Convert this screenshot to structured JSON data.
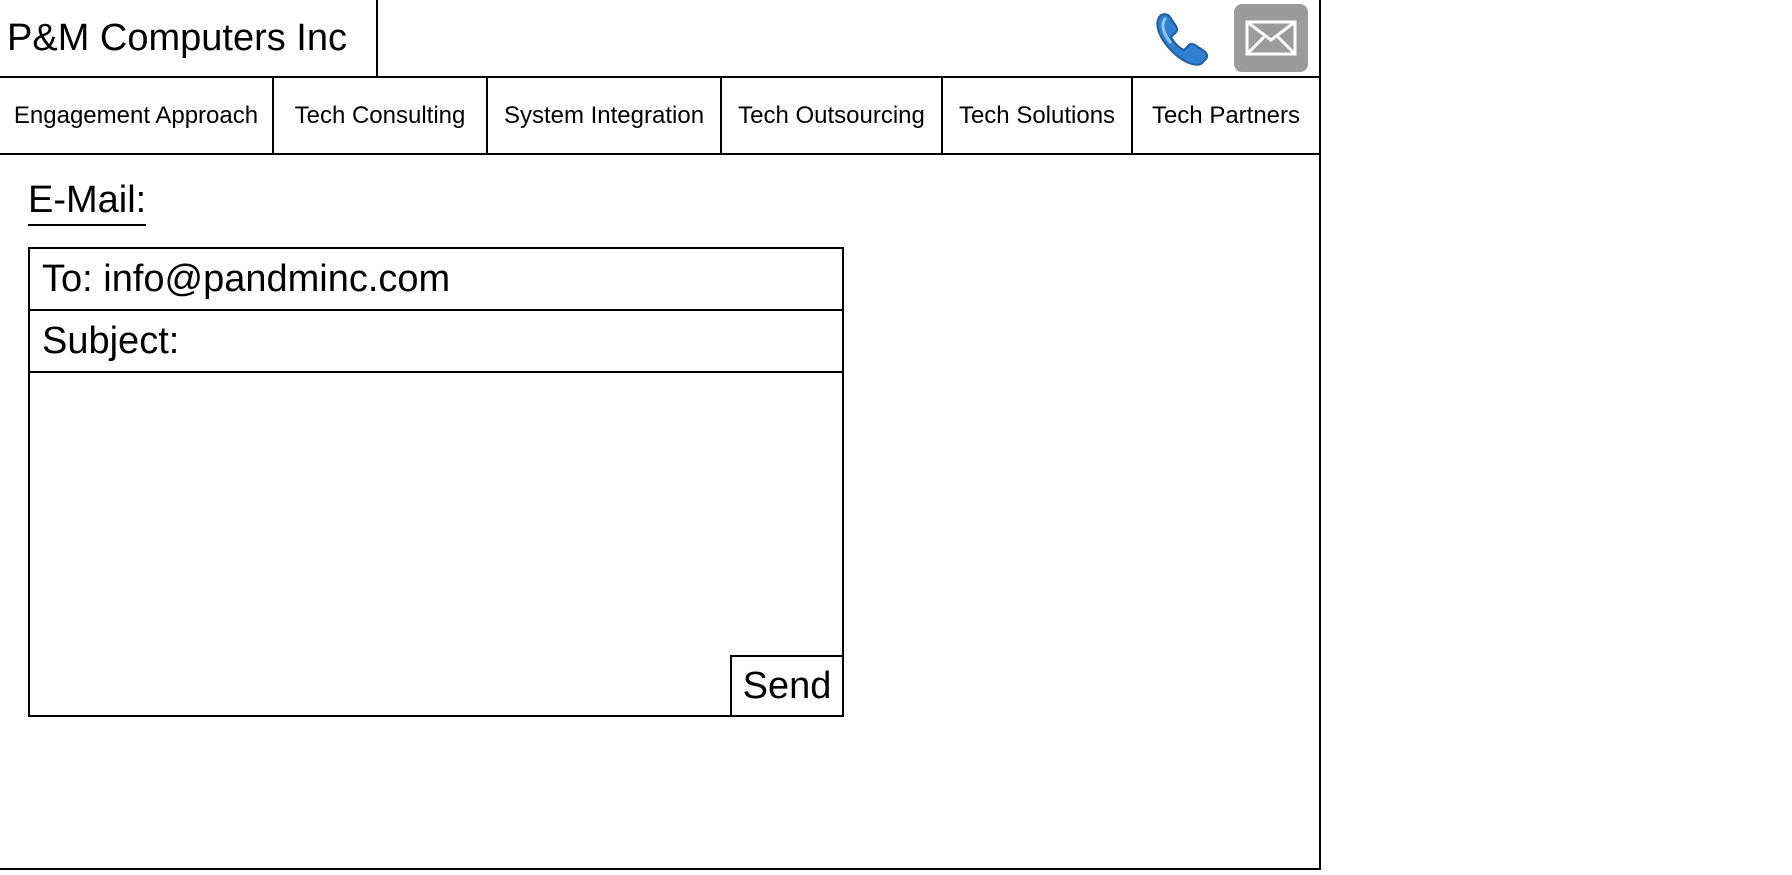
{
  "header": {
    "company_name": "P&M Computers Inc",
    "phone_icon": "phone-icon",
    "mail_icon": "envelope-icon",
    "phone_color": "#2f80d1",
    "mail_bg_color": "#9b9b9b"
  },
  "nav": {
    "items": [
      {
        "label": "Engagement Approach"
      },
      {
        "label": "Tech Consulting"
      },
      {
        "label": "System Integration"
      },
      {
        "label": "Tech Outsourcing"
      },
      {
        "label": "Tech Solutions"
      },
      {
        "label": "Tech Partners"
      }
    ]
  },
  "email": {
    "title": "E-Mail:",
    "to_label": "To: info@pandminc.com",
    "subject_label": "Subject:",
    "send_label": "Send"
  }
}
